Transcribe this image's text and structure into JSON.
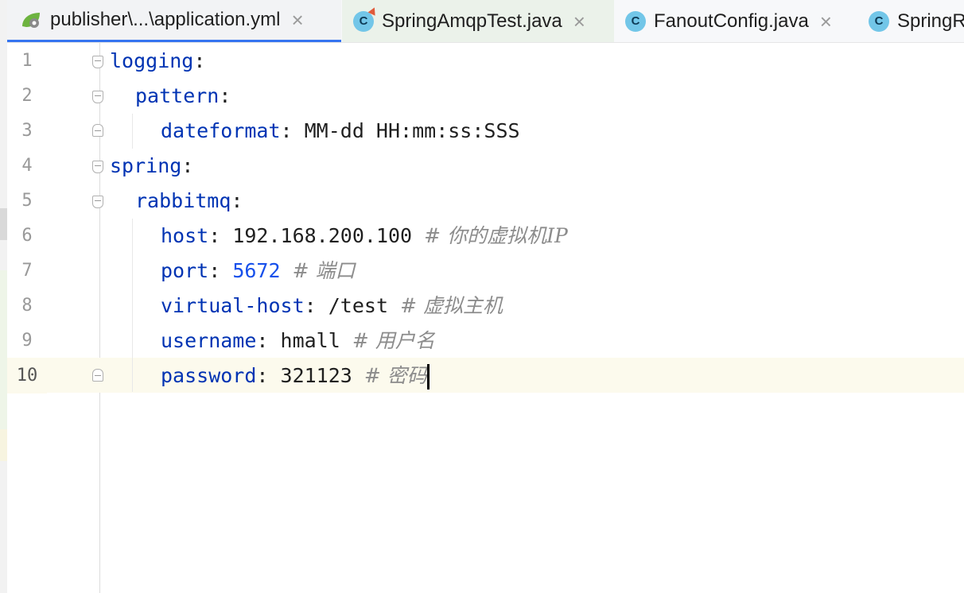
{
  "tabs": [
    {
      "label": "publisher\\...\\application.yml",
      "icon": "spring-yml-icon",
      "active": true,
      "close": "×"
    },
    {
      "label": "SpringAmqpTest.java",
      "icon": "java-class-icon",
      "close": "×"
    },
    {
      "label": "FanoutConfig.java",
      "icon": "java-class-icon",
      "close": "×"
    },
    {
      "label": "SpringR",
      "icon": "java-class-icon"
    }
  ],
  "class_icon_letter": "C",
  "lines": [
    {
      "num": "1",
      "key": "logging",
      "sep": ":"
    },
    {
      "num": "2",
      "key": "pattern",
      "sep": ":"
    },
    {
      "num": "3",
      "key": "dateformat",
      "sep": ": ",
      "value": "MM-dd HH:mm:ss:SSS"
    },
    {
      "num": "4",
      "key": "spring",
      "sep": ":"
    },
    {
      "num": "5",
      "key": "rabbitmq",
      "sep": ":"
    },
    {
      "num": "6",
      "key": "host",
      "sep": ": ",
      "value": "192.168.200.100",
      "comment": "# 你的虚拟机IP"
    },
    {
      "num": "7",
      "key": "port",
      "sep": ": ",
      "value": "5672",
      "comment": "# 端口"
    },
    {
      "num": "8",
      "key": "virtual-host",
      "sep": ": ",
      "value": "/test",
      "comment": "# 虚拟主机"
    },
    {
      "num": "9",
      "key": "username",
      "sep": ": ",
      "value": "hmall",
      "comment": "# 用户名"
    },
    {
      "num": "10",
      "key": "password",
      "sep": ": ",
      "value": "321123",
      "comment": "# 密码"
    }
  ],
  "colors": {
    "key": "#0033b3",
    "number": "#1750eb",
    "comment": "#8c8c8c",
    "active_tab_underline": "#3574f0",
    "current_line": "#fcfaed"
  }
}
